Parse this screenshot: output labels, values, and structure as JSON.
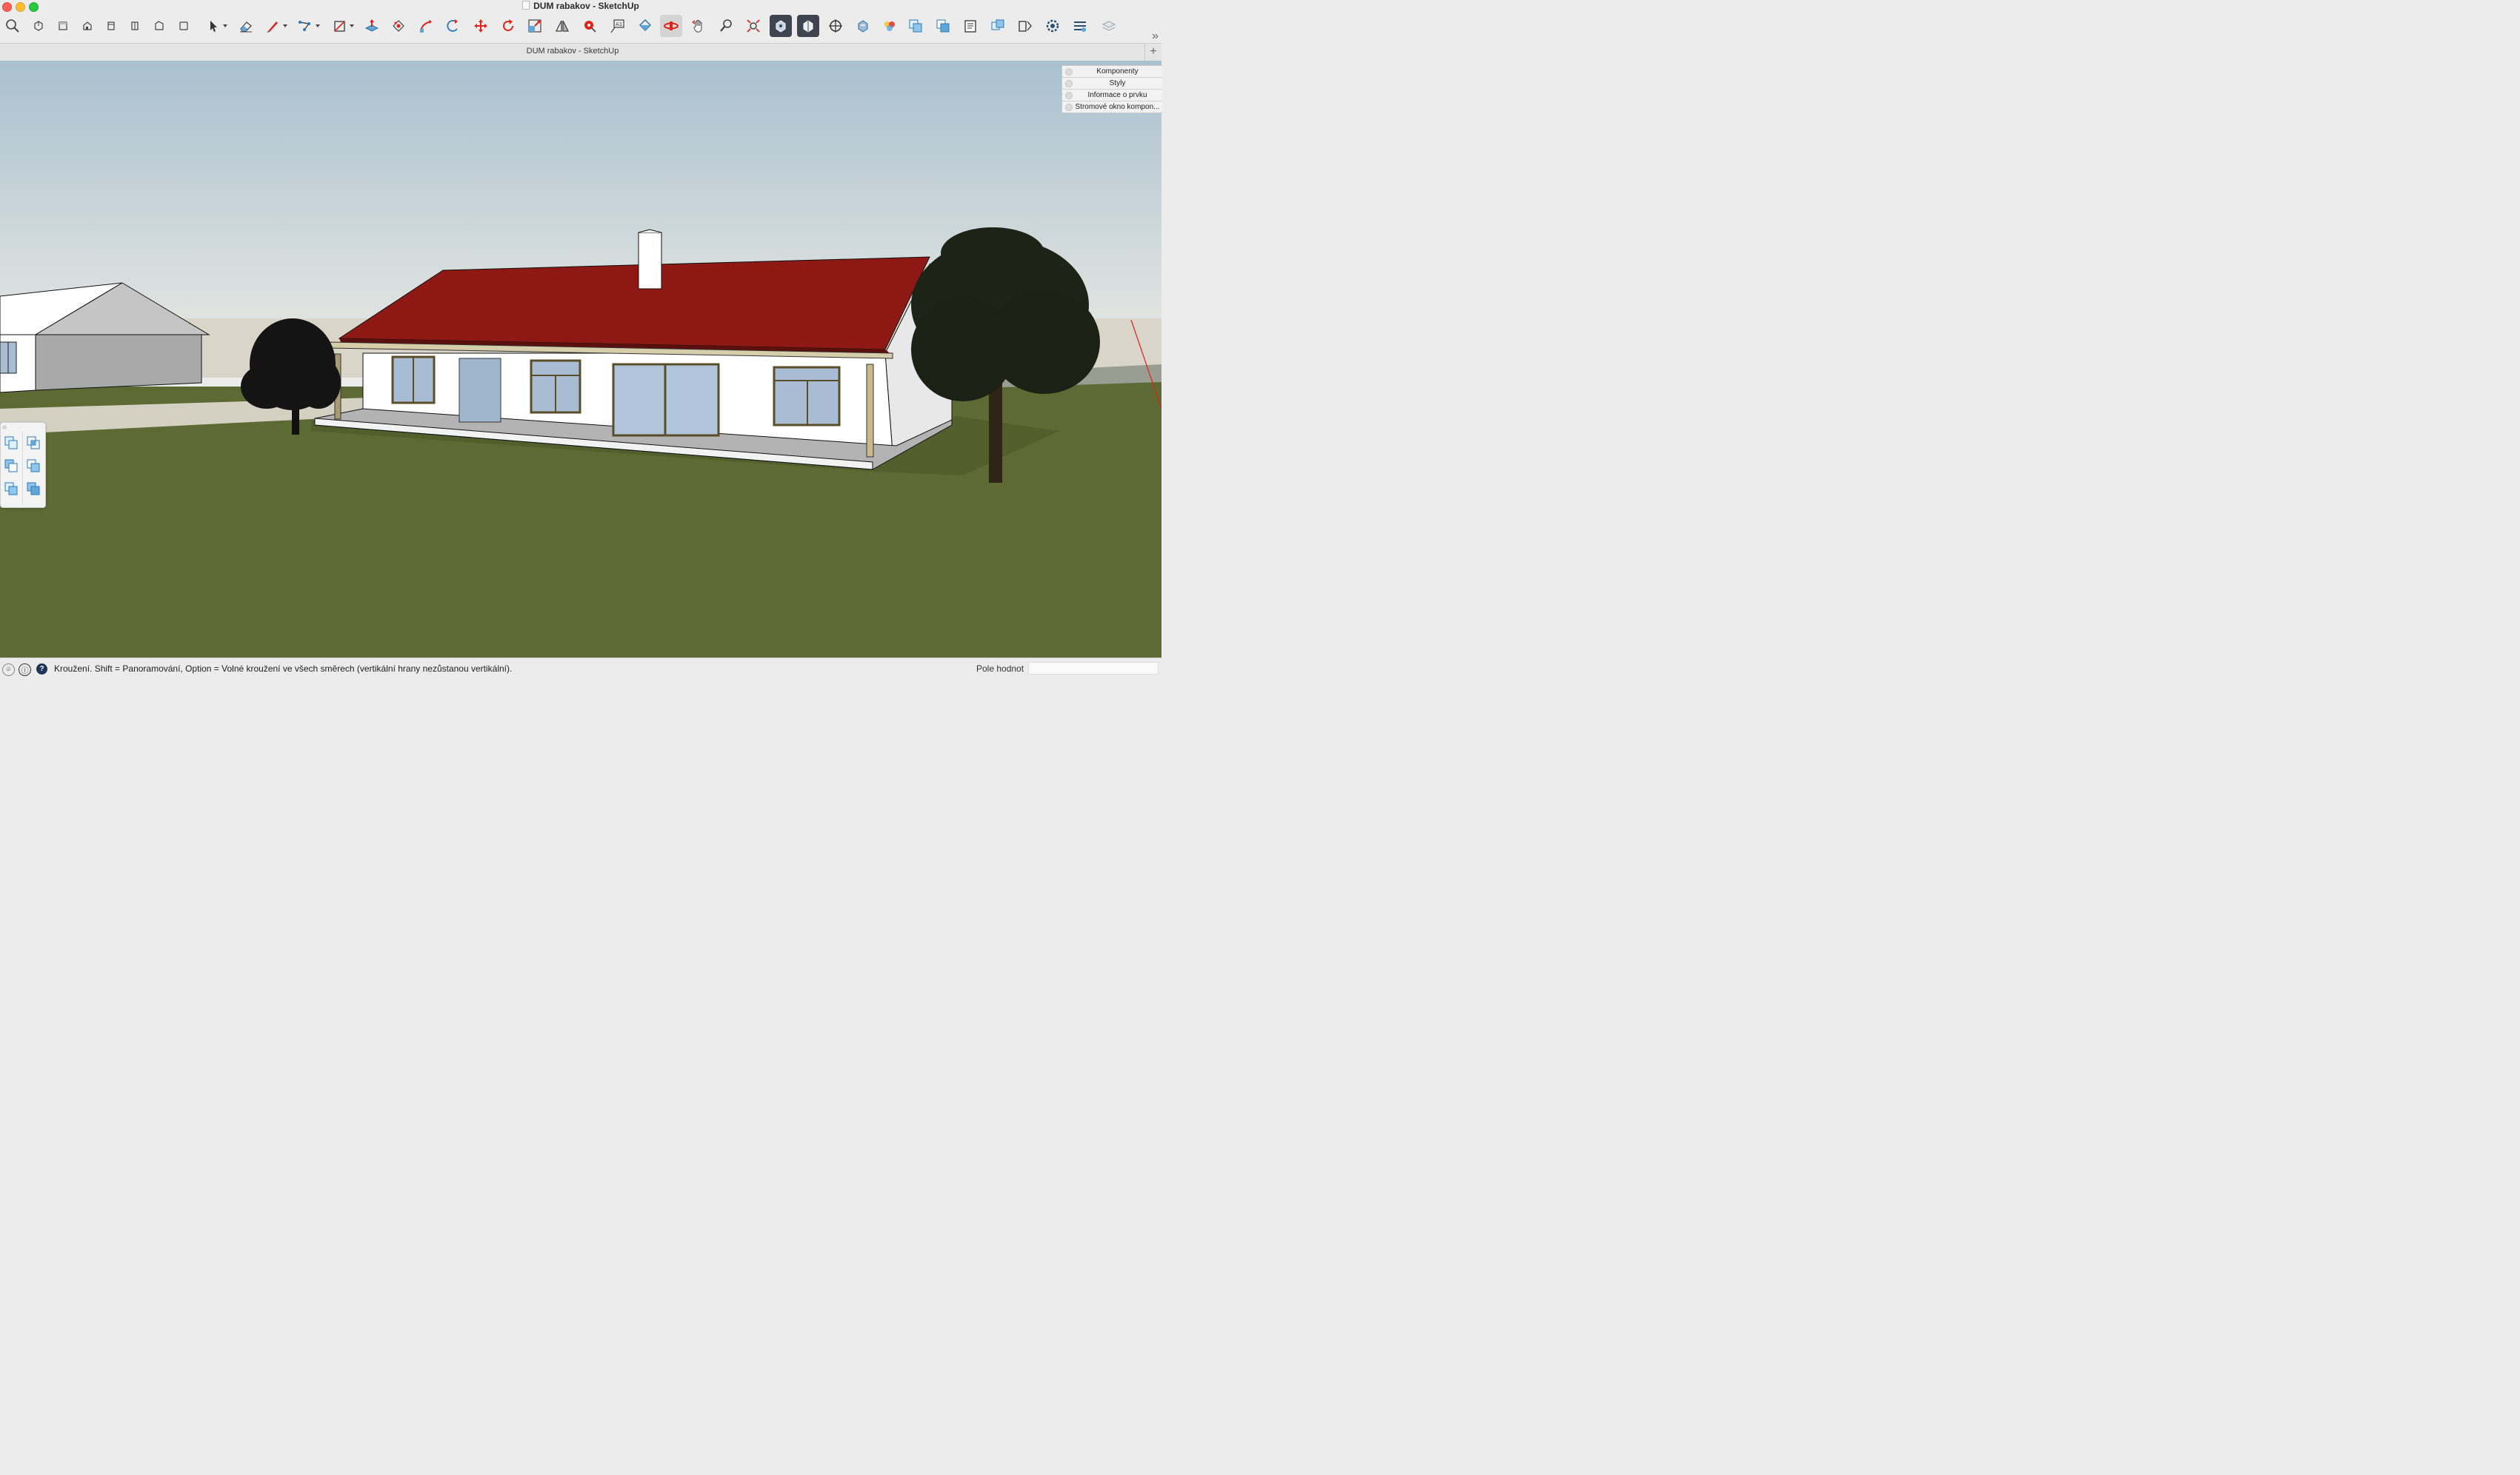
{
  "window": {
    "title": "DUM rabakov - SketchUp"
  },
  "toolbar": {
    "tools": [
      {
        "name": "zoom-icon"
      },
      {
        "name": "iso-view-icon"
      },
      {
        "name": "top-view-icon"
      },
      {
        "name": "front-view-icon"
      },
      {
        "name": "right-view-icon"
      },
      {
        "name": "back-view-icon"
      },
      {
        "name": "left-view-icon"
      },
      {
        "name": "bottom-view-icon"
      },
      {
        "name": "select-icon"
      },
      {
        "name": "eraser-icon"
      },
      {
        "name": "line-icon"
      },
      {
        "name": "arc-icon"
      },
      {
        "name": "rectangle-icon"
      },
      {
        "name": "push-pull-icon"
      },
      {
        "name": "offset-icon"
      },
      {
        "name": "follow-me-icon"
      },
      {
        "name": "rotate-arc-icon"
      },
      {
        "name": "move-icon"
      },
      {
        "name": "rotate-icon"
      },
      {
        "name": "scale-icon"
      },
      {
        "name": "flip-icon"
      },
      {
        "name": "tape-measure-icon"
      },
      {
        "name": "text-icon"
      },
      {
        "name": "paint-bucket-icon"
      },
      {
        "name": "orbit-icon"
      },
      {
        "name": "pan-icon"
      },
      {
        "name": "zoom-tool-icon"
      },
      {
        "name": "zoom-extents-icon"
      },
      {
        "name": "warehouse-icon"
      },
      {
        "name": "extension-warehouse-icon"
      },
      {
        "name": "position-camera-icon"
      },
      {
        "name": "look-around-icon"
      },
      {
        "name": "materials-icon"
      },
      {
        "name": "solid-union-icon"
      },
      {
        "name": "solid-subtract-icon"
      },
      {
        "name": "entity-info-icon"
      },
      {
        "name": "components-icon"
      },
      {
        "name": "scenes-icon"
      },
      {
        "name": "settings-icon"
      },
      {
        "name": "preferences-icon"
      },
      {
        "name": "layers-icon"
      }
    ],
    "more_label": "»"
  },
  "tab": {
    "title": "DUM rabakov - SketchUp",
    "add_label": "+"
  },
  "tray": {
    "items": [
      {
        "label": "Komponenty"
      },
      {
        "label": "Styly"
      },
      {
        "label": "Informace o prvku"
      },
      {
        "label": "Stromové okno kompon..."
      }
    ]
  },
  "palette": {
    "items": [
      {
        "name": "outer-shell-icon"
      },
      {
        "name": "intersect-icon"
      },
      {
        "name": "union-icon"
      },
      {
        "name": "subtract-icon"
      },
      {
        "name": "trim-icon"
      },
      {
        "name": "split-icon"
      }
    ]
  },
  "status": {
    "hint": "Kroužení. Shift = Panoramování, Option = Volné kroužení ve všech směrech (vertikální hrany nezůstanou vertikální).",
    "value_label": "Pole hodnot",
    "value": ""
  },
  "colors": {
    "sky_top": "#a9c0cf",
    "sky_bottom": "#dfe4e3",
    "grass": "#5d6a33",
    "roof": "#8e1914",
    "wall": "#ffffff",
    "accent_red": "#e0241b"
  }
}
